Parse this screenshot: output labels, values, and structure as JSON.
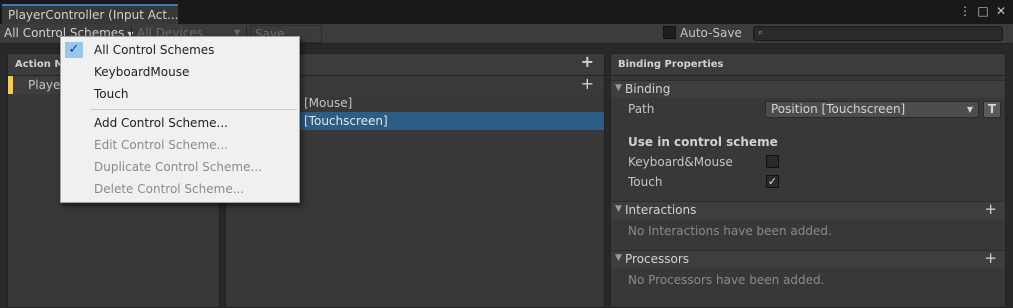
{
  "window": {
    "tab_title": "PlayerController (Input Act...",
    "controls": [
      "⋮",
      "□",
      "✕"
    ]
  },
  "toolbar": {
    "control_schemes_label": "All Control Schemes",
    "devices_label": "All Devices",
    "save_asset_label": "Save Asset",
    "auto_save_label": "Auto-Save",
    "search_icon": "⌕"
  },
  "action_maps": {
    "header": "Action Ma",
    "items": [
      {
        "label": "Playe"
      }
    ]
  },
  "actions": {
    "bindings": [
      {
        "label": "[Mouse]"
      },
      {
        "label": "[Touchscreen]"
      }
    ]
  },
  "properties": {
    "header": "Binding Properties",
    "binding_section": "Binding",
    "path_label": "Path",
    "path_value": "Position [Touchscreen]",
    "t_button": "T",
    "use_in_scheme_label": "Use in control scheme",
    "schemes": [
      {
        "label": "Keyboard&Mouse",
        "checked": false
      },
      {
        "label": "Touch",
        "checked": true
      }
    ],
    "interactions_title": "Interactions",
    "interactions_empty": "No Interactions have been added.",
    "processors_title": "Processors",
    "processors_empty": "No Processors have been added."
  },
  "dropdown_menu": {
    "items": [
      {
        "label": "All Control Schemes",
        "checked": true,
        "disabled": false
      },
      {
        "label": "KeyboardMouse",
        "checked": false,
        "disabled": false
      },
      {
        "label": "Touch",
        "checked": false,
        "disabled": false
      },
      {
        "label": "Add Control Scheme...",
        "checked": false,
        "disabled": false
      },
      {
        "label": "Edit Control Scheme...",
        "checked": false,
        "disabled": true
      },
      {
        "label": "Duplicate Control Scheme...",
        "checked": false,
        "disabled": true
      },
      {
        "label": "Delete Control Scheme...",
        "checked": false,
        "disabled": true
      }
    ]
  },
  "colors": {
    "selection": "#2c5d87",
    "tab_accent": "#3a79bb",
    "map_marker": "#f4c95d",
    "menu_check_bg": "#99c6ef"
  }
}
